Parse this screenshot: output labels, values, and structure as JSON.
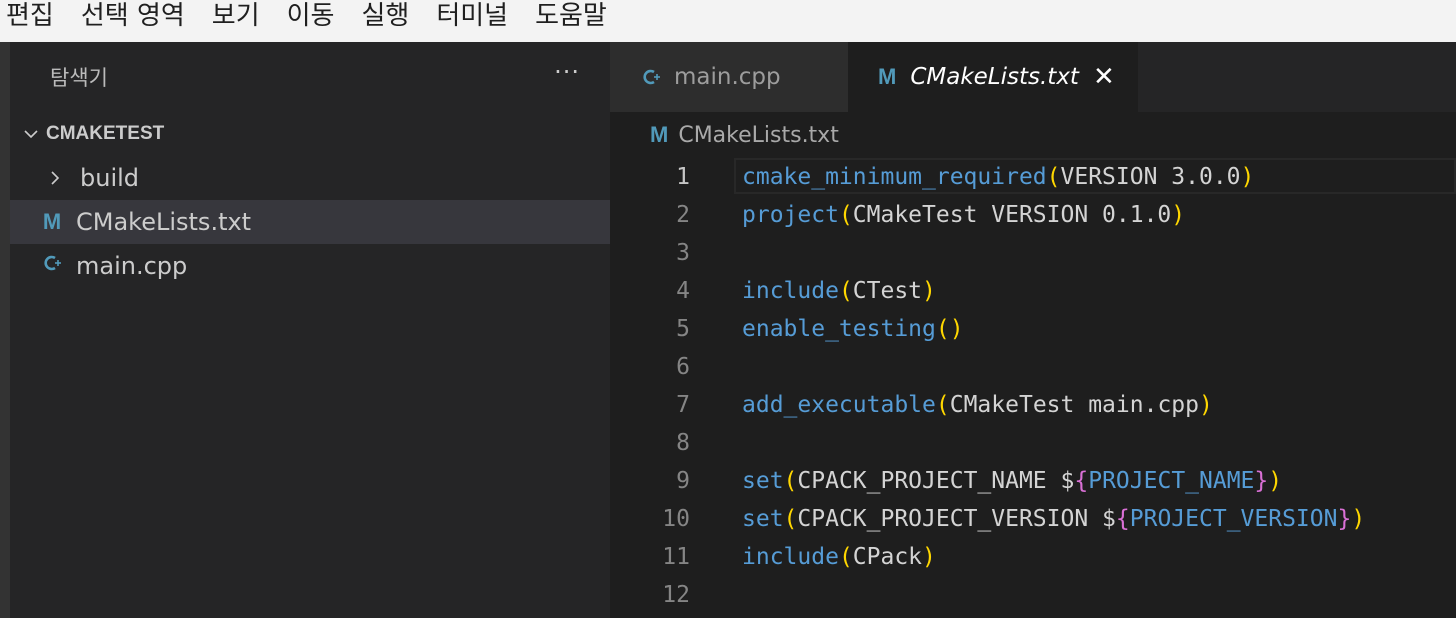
{
  "menubar": {
    "items": [
      "편집",
      "선택 영역",
      "보기",
      "이동",
      "실행",
      "터미널",
      "도움말"
    ]
  },
  "sidebar": {
    "title": "탐색기",
    "more_label": "···",
    "section_title": "CMAKETEST",
    "tree": [
      {
        "label": "build",
        "kind": "folder",
        "icon": "chevron-right-icon"
      },
      {
        "label": "CMakeLists.txt",
        "kind": "file",
        "icon": "cmake-m-icon",
        "icon_glyph": "M",
        "selected": true
      },
      {
        "label": "main.cpp",
        "kind": "file",
        "icon": "cpp-icon",
        "icon_glyph": "G"
      }
    ]
  },
  "editor": {
    "tabs": [
      {
        "label": "main.cpp",
        "icon": "cpp-icon",
        "active": false
      },
      {
        "label": "CMakeLists.txt",
        "icon": "cmake-m-icon",
        "active": true,
        "close_glyph": "✕"
      }
    ],
    "breadcrumb": "CMakeLists.txt",
    "lines": [
      {
        "n": "1",
        "text": "cmake_minimum_required(VERSION 3.0.0)"
      },
      {
        "n": "2",
        "text": "project(CMakeTest VERSION 0.1.0)"
      },
      {
        "n": "3",
        "text": ""
      },
      {
        "n": "4",
        "text": "include(CTest)"
      },
      {
        "n": "5",
        "text": "enable_testing()"
      },
      {
        "n": "6",
        "text": ""
      },
      {
        "n": "7",
        "text": "add_executable(CMakeTest main.cpp)"
      },
      {
        "n": "8",
        "text": ""
      },
      {
        "n": "9",
        "text": "set(CPACK_PROJECT_NAME ${PROJECT_NAME})"
      },
      {
        "n": "10",
        "text": "set(CPACK_PROJECT_VERSION ${PROJECT_VERSION})"
      },
      {
        "n": "11",
        "text": "include(CPack)"
      },
      {
        "n": "12",
        "text": ""
      }
    ],
    "active_line": "1"
  },
  "colors": {
    "keyword": "#569cd6",
    "paren": "#ffd700",
    "brace": "#da70d6",
    "text": "#d4d4d4",
    "icon_blue": "#519aba"
  }
}
